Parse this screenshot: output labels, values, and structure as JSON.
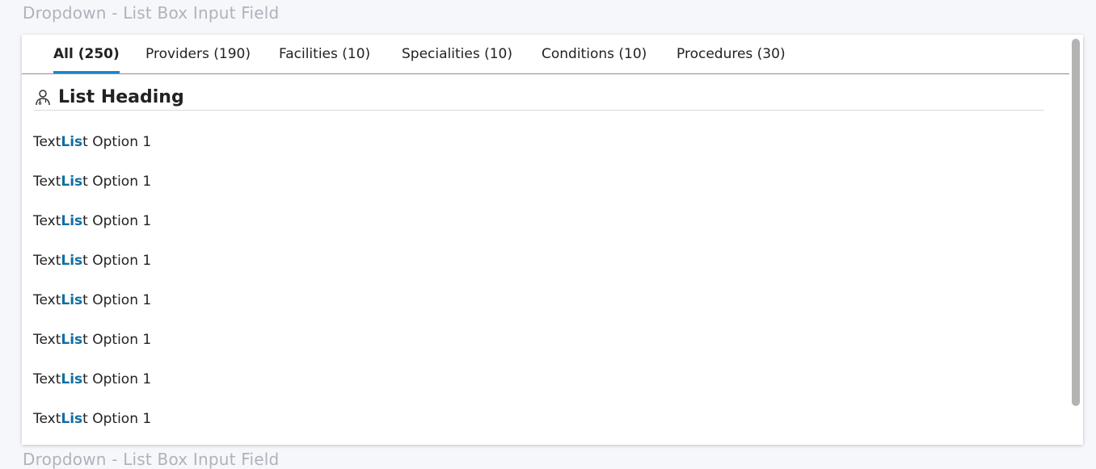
{
  "captions": {
    "top": "Dropdown - List Box Input Field",
    "bottom": "Dropdown - List Box Input Field"
  },
  "tabs": [
    {
      "label": "All (250)",
      "active": true
    },
    {
      "label": "Providers (190)",
      "active": false
    },
    {
      "label": "Facilities (10)",
      "active": false
    },
    {
      "label": "Specialities (10)",
      "active": false
    },
    {
      "label": "Conditions (10)",
      "active": false
    },
    {
      "label": "Procedures (30)",
      "active": false
    }
  ],
  "list": {
    "heading": "List Heading",
    "heading_icon": "doctor-icon",
    "options": [
      {
        "prefix": "Text",
        "match": "Lis",
        "suffix": "t Option 1"
      },
      {
        "prefix": "Text",
        "match": "Lis",
        "suffix": "t Option 1"
      },
      {
        "prefix": "Text",
        "match": "Lis",
        "suffix": "t Option 1"
      },
      {
        "prefix": "Text",
        "match": "Lis",
        "suffix": "t Option 1"
      },
      {
        "prefix": "Text",
        "match": "Lis",
        "suffix": "t Option 1"
      },
      {
        "prefix": "Text",
        "match": "Lis",
        "suffix": "t Option 1"
      },
      {
        "prefix": "Text",
        "match": "Lis",
        "suffix": "t Option 1"
      },
      {
        "prefix": "Text",
        "match": "Lis",
        "suffix": "t Option 1"
      }
    ]
  },
  "colors": {
    "active_tab_underline": "#1a86c6",
    "match_highlight": "#0f6fa3",
    "caption": "#aeb3bb"
  }
}
